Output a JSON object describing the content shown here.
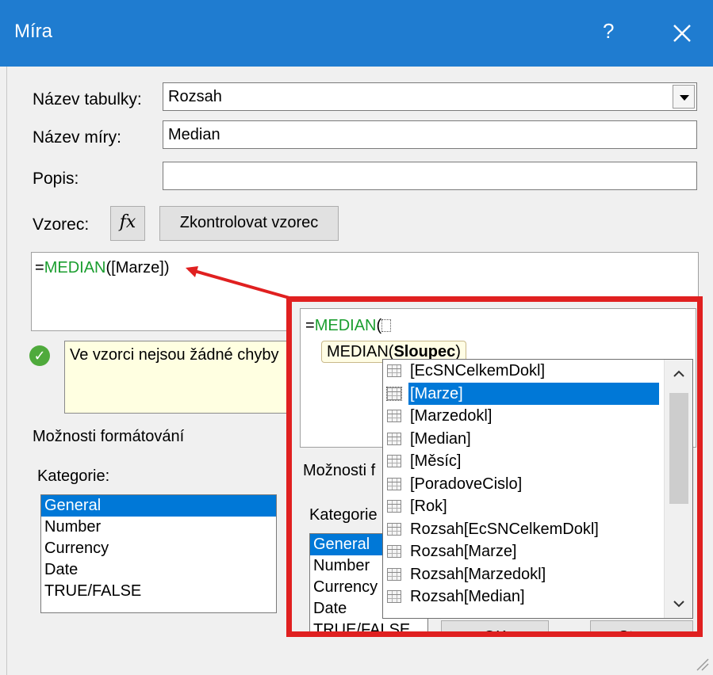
{
  "window": {
    "title": "Míra",
    "help_glyph": "?"
  },
  "form": {
    "table_label": "Název tabulky:",
    "table_value": "Rozsah",
    "measure_label": "Název míry:",
    "measure_value": "Median",
    "description_label": "Popis:",
    "description_value": "",
    "formula_label": "Vzorec:",
    "fx_label": "fx",
    "check_button": "Zkontrolovat vzorec",
    "formula_fn": "MEDIAN",
    "formula_rest": "([Marze])",
    "formula_prefix": "=",
    "status_message": "Ve vzorci nejsou žádné chyby"
  },
  "formatting": {
    "section_label": "Možnosti formátování",
    "category_label": "Kategorie:",
    "categories": [
      "General",
      "Number",
      "Currency",
      "Date",
      "TRUE/FALSE"
    ],
    "selected_category": "General"
  },
  "zoom": {
    "formula_prefix": "=",
    "formula_fn": "MEDIAN",
    "formula_paren": "(",
    "tooltip_fn": "MEDIAN(",
    "tooltip_arg": "Sloupec",
    "tooltip_close": ")",
    "section_label_partial": "Možnosti f",
    "category_label_partial": "Kategorie",
    "categories": [
      "General",
      "Number",
      "Currency",
      "Date",
      "TRUE/FALSE"
    ],
    "ok_partial": "OK",
    "cancel_partial": "Storno",
    "autocomplete": [
      "[EcSNCelkemDokl]",
      "[Marze]",
      "[Marzedokl]",
      "[Median]",
      "[Měsíc]",
      "[PoradoveCislo]",
      "[Rok]",
      "Rozsah[EcSNCelkemDokl]",
      "Rozsah[Marze]",
      "Rozsah[Marzedokl]",
      "Rozsah[Median]"
    ],
    "selected_item": "[Marze]"
  },
  "colors": {
    "titlebar": "#1f7cd0",
    "highlight": "#e02020",
    "function_green": "#1b9e2f",
    "selection": "#0078d7"
  }
}
